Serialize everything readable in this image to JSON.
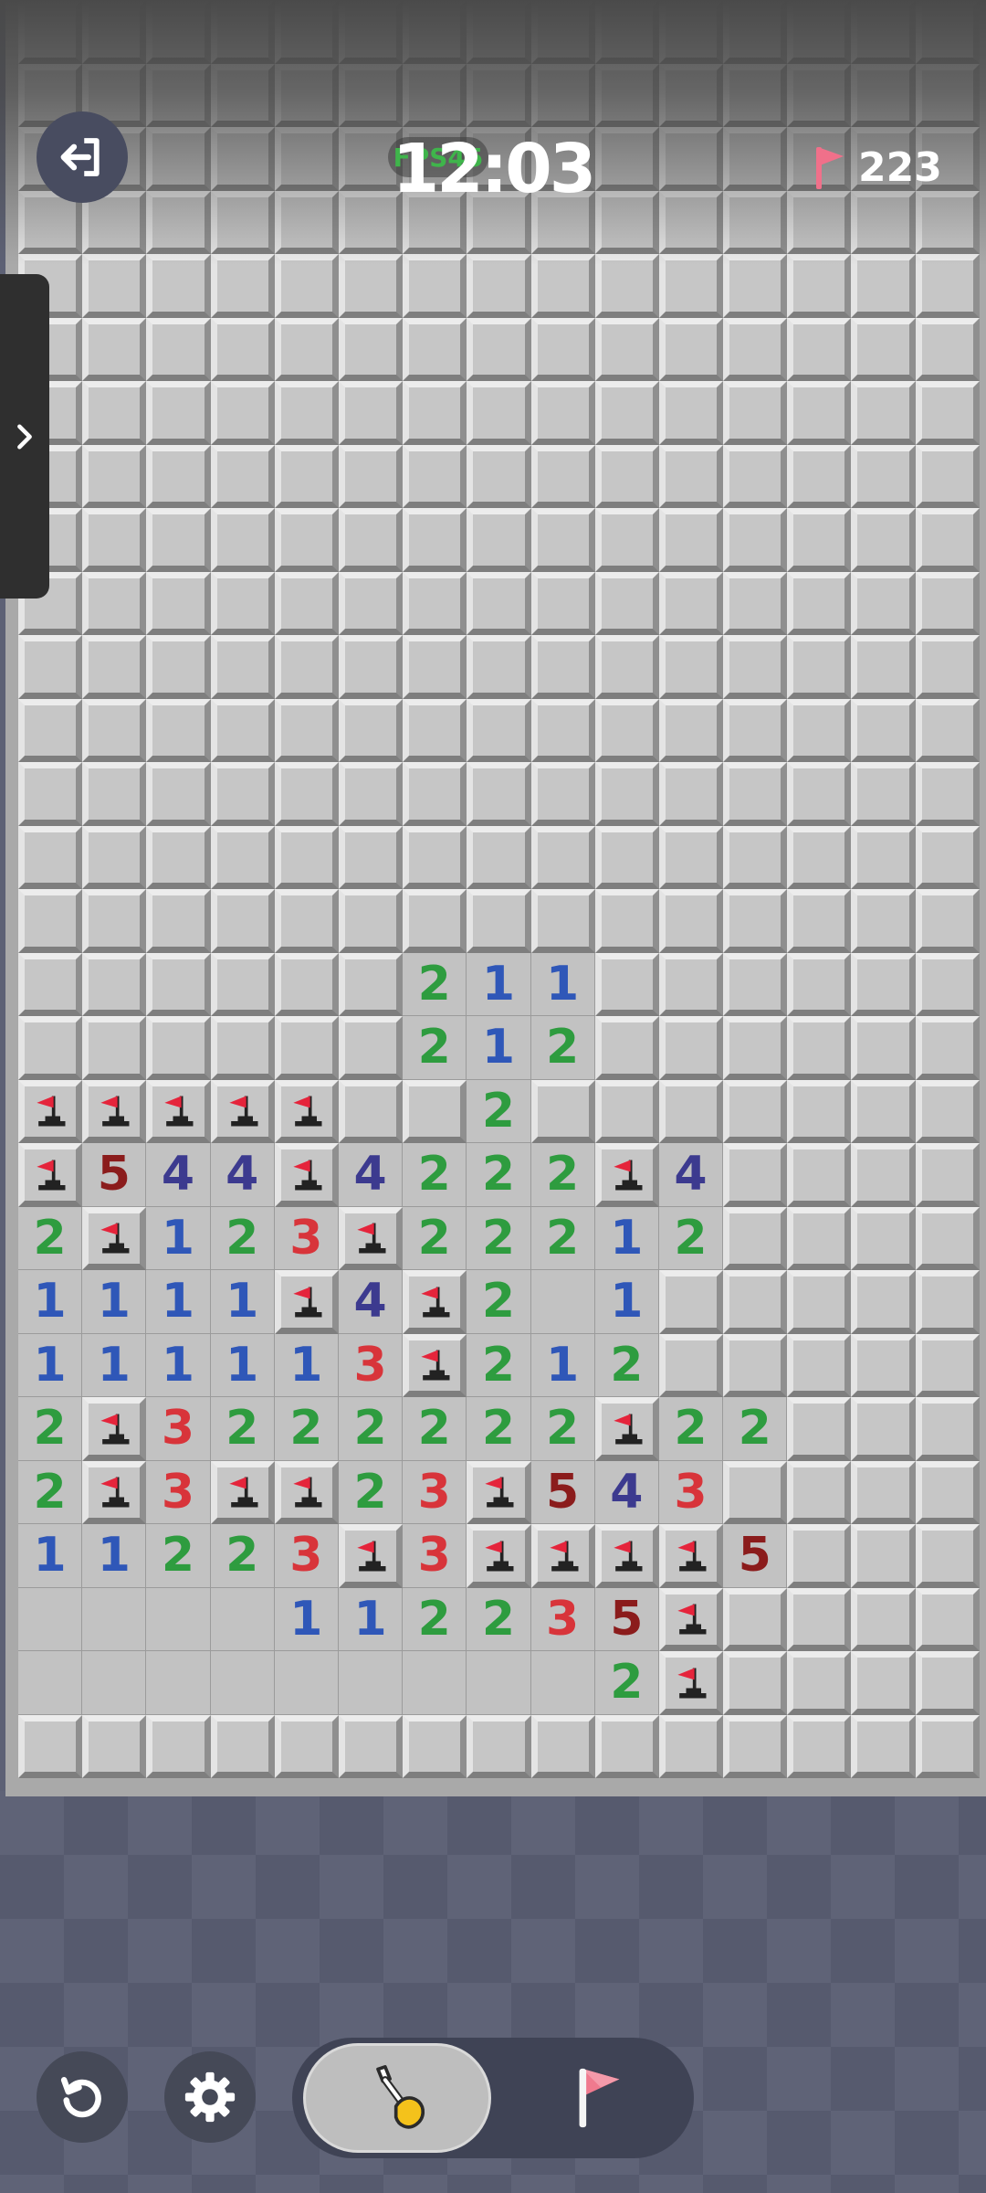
{
  "header": {
    "fps_label": "FPS45",
    "timer": "12:03",
    "flags_remaining": "223"
  },
  "board": {
    "cols": 15,
    "rows": 28,
    "legend": "C = closed tile, F = flag, O = opened empty tile, 1-5 = number",
    "grid": [
      "CCCCCCCCCCCCCCC",
      "CCCCCCCCCCCCCCC",
      "CCCCCCCCCCCCCCC",
      "CCCCCCCCCCCCCCC",
      "CCCCCCCCCCCCCCC",
      "CCCCCCCCCCCCCCC",
      "CCCCCCCCCCCCCCC",
      "CCCCCCCCCCCCCCC",
      "CCCCCCCCCCCCCCC",
      "CCCCCCCCCCCCCCC",
      "CCCCCCCCCCCCCCC",
      "CCCCCCCCCCCCCCC",
      "CCCCCCCCCCCCCCC",
      "CCCCCCCCCCCCCCC",
      "CCCCCCCCCCCCCCC",
      "CCCCCC211CCCCCC",
      "CCCCCC212CCCCCC",
      "FFFFFCC2CCCCCCC",
      "F544F4222F4CCCC",
      "2F123F22212CCCC",
      "1111F4F2O1CCCCC",
      "111113F212CCCCC",
      "2F3222222F22CCC",
      "2F3FF23F543CCCC",
      "11223F3FFFF5CCC",
      "OOOO112235FCCCC",
      "OOOOOOOOO2FCCCC"
    ]
  },
  "controls": {
    "exit_icon": "exit-icon",
    "drawer_icon": "chevron-right-icon",
    "restart_icon": "restart-icon",
    "settings_icon": "gear-icon",
    "dig_icon": "shovel-icon",
    "flag_icon": "flag-icon"
  },
  "colors": {
    "n1": "#2f57b8",
    "n2": "#2e9c3f",
    "n3": "#d8343a",
    "n4": "#3c3a8f",
    "n5": "#8b1c1c",
    "flag": "#e8445a"
  }
}
